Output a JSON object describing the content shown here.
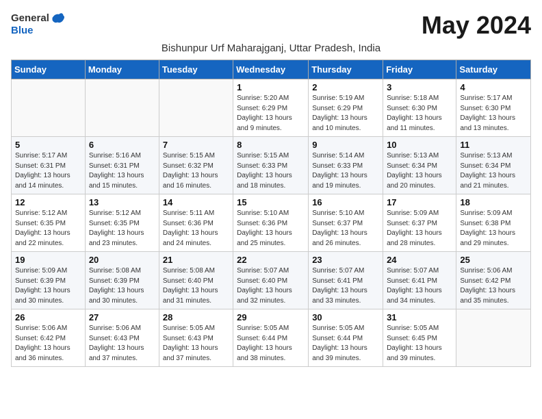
{
  "logo": {
    "general": "General",
    "blue": "Blue"
  },
  "title": "May 2024",
  "subtitle": "Bishunpur Urf Maharajganj, Uttar Pradesh, India",
  "headers": [
    "Sunday",
    "Monday",
    "Tuesday",
    "Wednesday",
    "Thursday",
    "Friday",
    "Saturday"
  ],
  "weeks": [
    [
      {
        "day": "",
        "sunrise": "",
        "sunset": "",
        "daylight": ""
      },
      {
        "day": "",
        "sunrise": "",
        "sunset": "",
        "daylight": ""
      },
      {
        "day": "",
        "sunrise": "",
        "sunset": "",
        "daylight": ""
      },
      {
        "day": "1",
        "sunrise": "Sunrise: 5:20 AM",
        "sunset": "Sunset: 6:29 PM",
        "daylight": "Daylight: 13 hours and 9 minutes."
      },
      {
        "day": "2",
        "sunrise": "Sunrise: 5:19 AM",
        "sunset": "Sunset: 6:29 PM",
        "daylight": "Daylight: 13 hours and 10 minutes."
      },
      {
        "day": "3",
        "sunrise": "Sunrise: 5:18 AM",
        "sunset": "Sunset: 6:30 PM",
        "daylight": "Daylight: 13 hours and 11 minutes."
      },
      {
        "day": "4",
        "sunrise": "Sunrise: 5:17 AM",
        "sunset": "Sunset: 6:30 PM",
        "daylight": "Daylight: 13 hours and 13 minutes."
      }
    ],
    [
      {
        "day": "5",
        "sunrise": "Sunrise: 5:17 AM",
        "sunset": "Sunset: 6:31 PM",
        "daylight": "Daylight: 13 hours and 14 minutes."
      },
      {
        "day": "6",
        "sunrise": "Sunrise: 5:16 AM",
        "sunset": "Sunset: 6:31 PM",
        "daylight": "Daylight: 13 hours and 15 minutes."
      },
      {
        "day": "7",
        "sunrise": "Sunrise: 5:15 AM",
        "sunset": "Sunset: 6:32 PM",
        "daylight": "Daylight: 13 hours and 16 minutes."
      },
      {
        "day": "8",
        "sunrise": "Sunrise: 5:15 AM",
        "sunset": "Sunset: 6:33 PM",
        "daylight": "Daylight: 13 hours and 18 minutes."
      },
      {
        "day": "9",
        "sunrise": "Sunrise: 5:14 AM",
        "sunset": "Sunset: 6:33 PM",
        "daylight": "Daylight: 13 hours and 19 minutes."
      },
      {
        "day": "10",
        "sunrise": "Sunrise: 5:13 AM",
        "sunset": "Sunset: 6:34 PM",
        "daylight": "Daylight: 13 hours and 20 minutes."
      },
      {
        "day": "11",
        "sunrise": "Sunrise: 5:13 AM",
        "sunset": "Sunset: 6:34 PM",
        "daylight": "Daylight: 13 hours and 21 minutes."
      }
    ],
    [
      {
        "day": "12",
        "sunrise": "Sunrise: 5:12 AM",
        "sunset": "Sunset: 6:35 PM",
        "daylight": "Daylight: 13 hours and 22 minutes."
      },
      {
        "day": "13",
        "sunrise": "Sunrise: 5:12 AM",
        "sunset": "Sunset: 6:35 PM",
        "daylight": "Daylight: 13 hours and 23 minutes."
      },
      {
        "day": "14",
        "sunrise": "Sunrise: 5:11 AM",
        "sunset": "Sunset: 6:36 PM",
        "daylight": "Daylight: 13 hours and 24 minutes."
      },
      {
        "day": "15",
        "sunrise": "Sunrise: 5:10 AM",
        "sunset": "Sunset: 6:36 PM",
        "daylight": "Daylight: 13 hours and 25 minutes."
      },
      {
        "day": "16",
        "sunrise": "Sunrise: 5:10 AM",
        "sunset": "Sunset: 6:37 PM",
        "daylight": "Daylight: 13 hours and 26 minutes."
      },
      {
        "day": "17",
        "sunrise": "Sunrise: 5:09 AM",
        "sunset": "Sunset: 6:37 PM",
        "daylight": "Daylight: 13 hours and 28 minutes."
      },
      {
        "day": "18",
        "sunrise": "Sunrise: 5:09 AM",
        "sunset": "Sunset: 6:38 PM",
        "daylight": "Daylight: 13 hours and 29 minutes."
      }
    ],
    [
      {
        "day": "19",
        "sunrise": "Sunrise: 5:09 AM",
        "sunset": "Sunset: 6:39 PM",
        "daylight": "Daylight: 13 hours and 30 minutes."
      },
      {
        "day": "20",
        "sunrise": "Sunrise: 5:08 AM",
        "sunset": "Sunset: 6:39 PM",
        "daylight": "Daylight: 13 hours and 30 minutes."
      },
      {
        "day": "21",
        "sunrise": "Sunrise: 5:08 AM",
        "sunset": "Sunset: 6:40 PM",
        "daylight": "Daylight: 13 hours and 31 minutes."
      },
      {
        "day": "22",
        "sunrise": "Sunrise: 5:07 AM",
        "sunset": "Sunset: 6:40 PM",
        "daylight": "Daylight: 13 hours and 32 minutes."
      },
      {
        "day": "23",
        "sunrise": "Sunrise: 5:07 AM",
        "sunset": "Sunset: 6:41 PM",
        "daylight": "Daylight: 13 hours and 33 minutes."
      },
      {
        "day": "24",
        "sunrise": "Sunrise: 5:07 AM",
        "sunset": "Sunset: 6:41 PM",
        "daylight": "Daylight: 13 hours and 34 minutes."
      },
      {
        "day": "25",
        "sunrise": "Sunrise: 5:06 AM",
        "sunset": "Sunset: 6:42 PM",
        "daylight": "Daylight: 13 hours and 35 minutes."
      }
    ],
    [
      {
        "day": "26",
        "sunrise": "Sunrise: 5:06 AM",
        "sunset": "Sunset: 6:42 PM",
        "daylight": "Daylight: 13 hours and 36 minutes."
      },
      {
        "day": "27",
        "sunrise": "Sunrise: 5:06 AM",
        "sunset": "Sunset: 6:43 PM",
        "daylight": "Daylight: 13 hours and 37 minutes."
      },
      {
        "day": "28",
        "sunrise": "Sunrise: 5:05 AM",
        "sunset": "Sunset: 6:43 PM",
        "daylight": "Daylight: 13 hours and 37 minutes."
      },
      {
        "day": "29",
        "sunrise": "Sunrise: 5:05 AM",
        "sunset": "Sunset: 6:44 PM",
        "daylight": "Daylight: 13 hours and 38 minutes."
      },
      {
        "day": "30",
        "sunrise": "Sunrise: 5:05 AM",
        "sunset": "Sunset: 6:44 PM",
        "daylight": "Daylight: 13 hours and 39 minutes."
      },
      {
        "day": "31",
        "sunrise": "Sunrise: 5:05 AM",
        "sunset": "Sunset: 6:45 PM",
        "daylight": "Daylight: 13 hours and 39 minutes."
      },
      {
        "day": "",
        "sunrise": "",
        "sunset": "",
        "daylight": ""
      }
    ]
  ]
}
